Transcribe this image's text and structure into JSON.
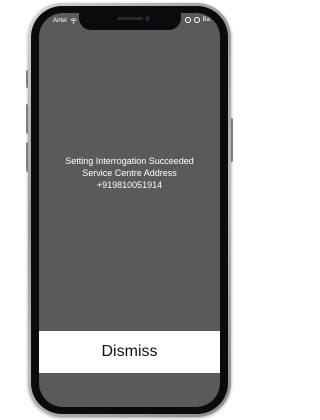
{
  "status_bar": {
    "carrier": "Airtel",
    "wifi_icon": "wifi-icon",
    "right_icons": [
      "location-icon",
      "alarm-icon"
    ],
    "battery_text": "Ba"
  },
  "dialog": {
    "lines": [
      "Setting Interrogation Succeeded",
      "Service Centre Address",
      "+919810051914"
    ],
    "dismiss_label": "Dismiss"
  },
  "colors": {
    "screen_background": "#5a5a5a",
    "button_background": "#ffffff",
    "text_on_screen": "#ffffff"
  }
}
